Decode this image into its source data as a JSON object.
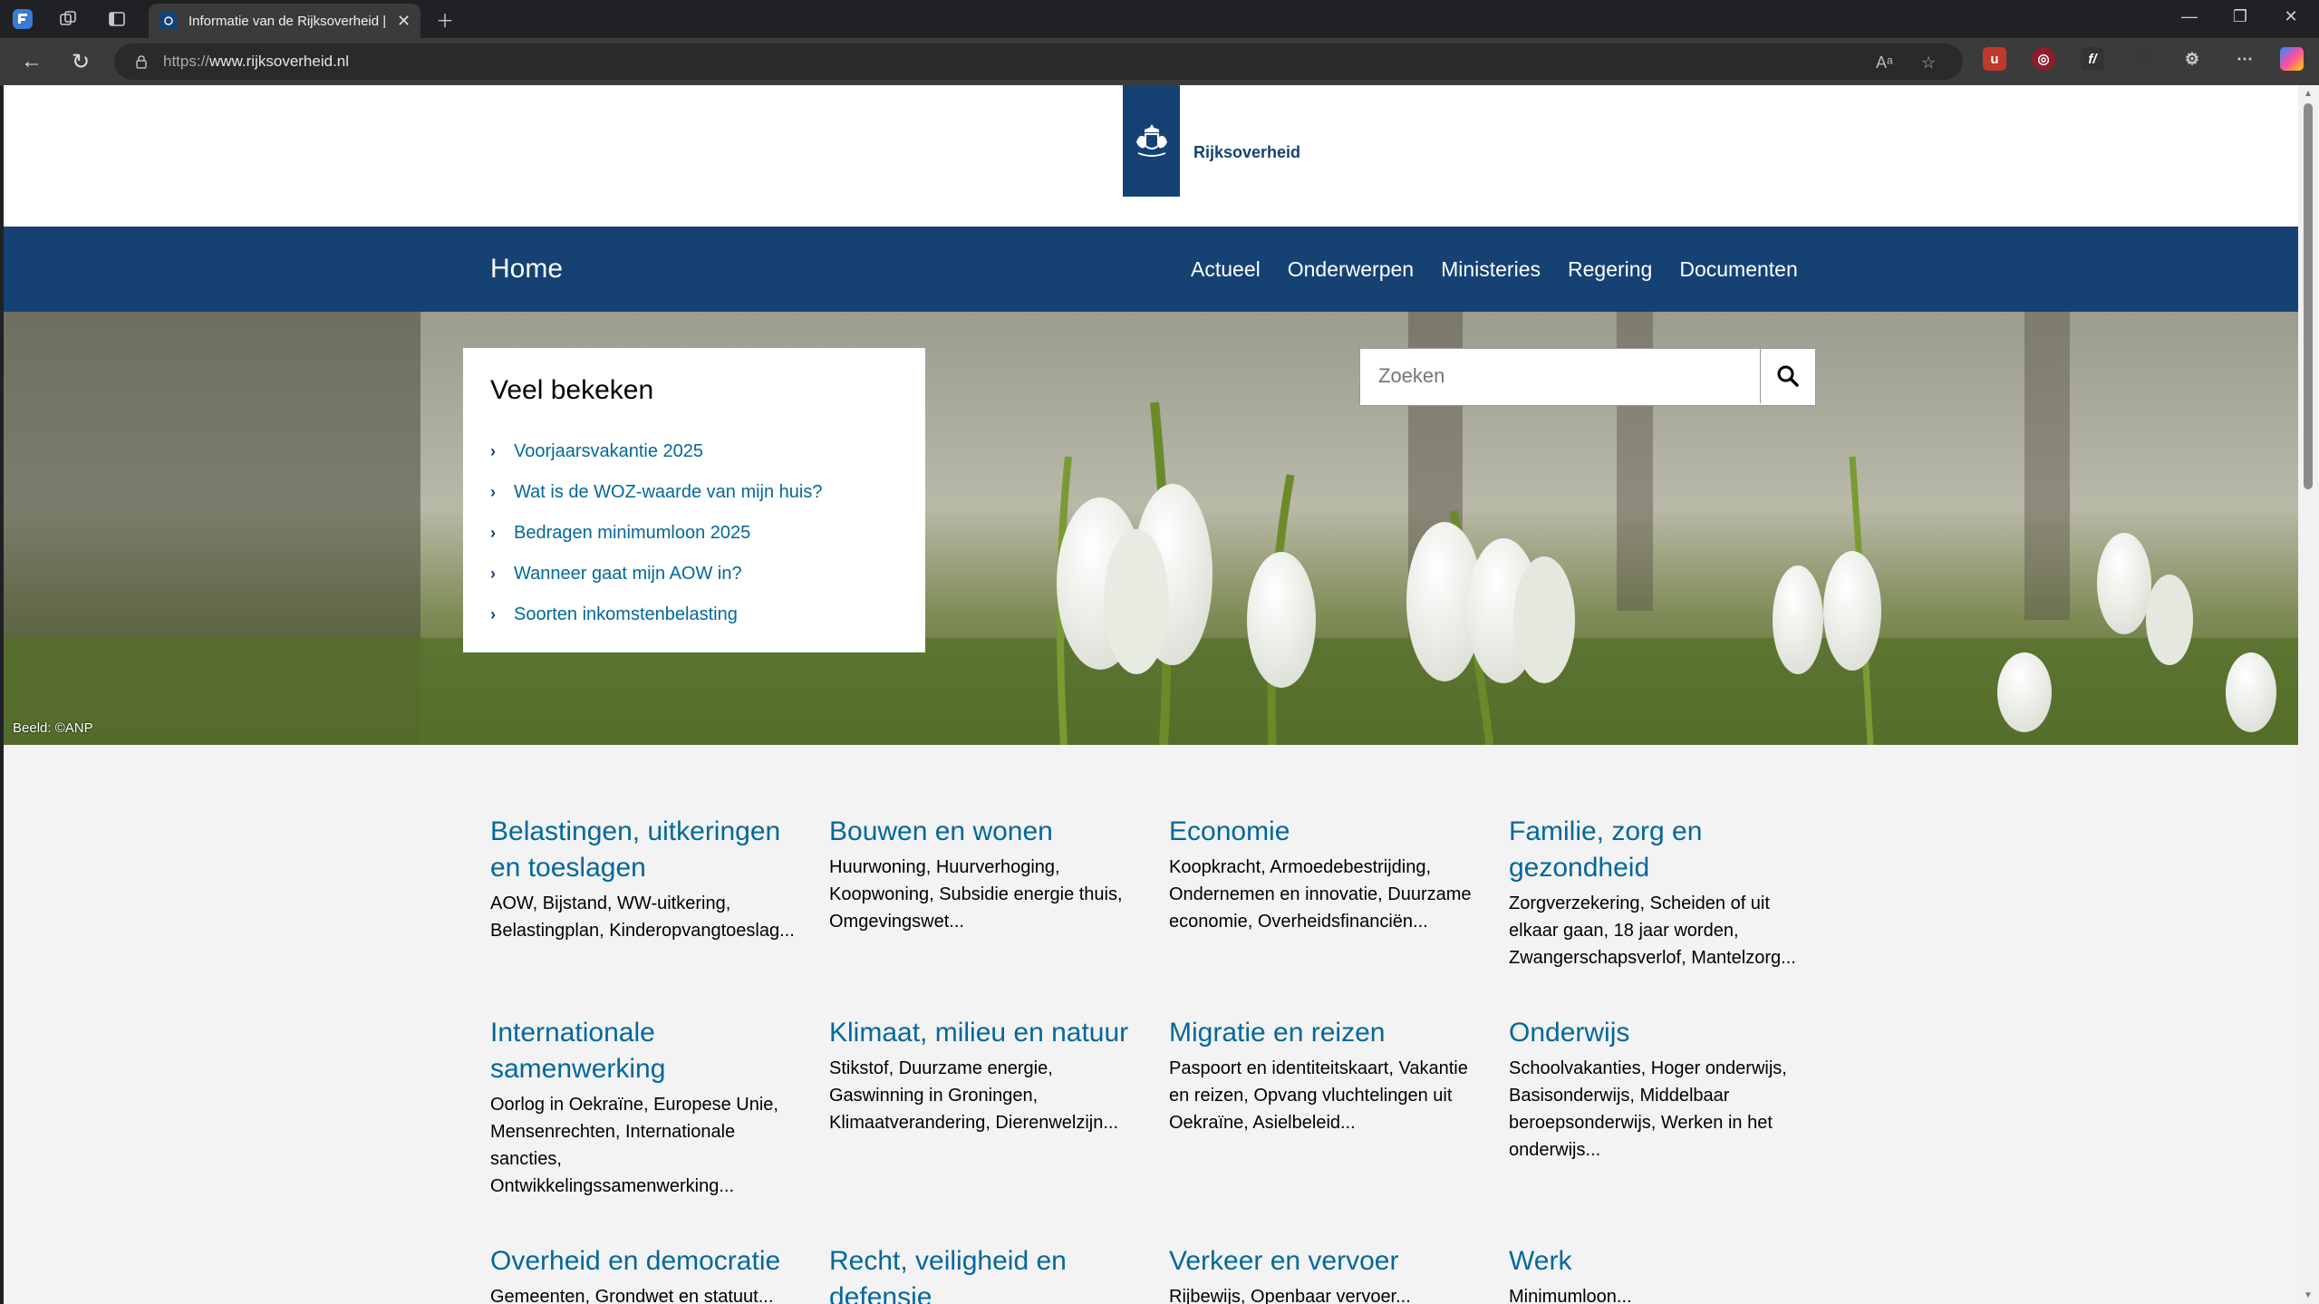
{
  "browser": {
    "tab_title": "Informatie van de Rijksoverheid |",
    "url_prefix": "https://",
    "url_host": "www.rijksoverheid.nl"
  },
  "site": {
    "logo_text": "Rijksoverheid",
    "nav_home": "Home",
    "nav_items": [
      "Actueel",
      "Onderwerpen",
      "Ministeries",
      "Regering",
      "Documenten"
    ],
    "colors": {
      "brand": "#154273",
      "link": "#01689b"
    }
  },
  "hero": {
    "credit": "Beeld: ©ANP",
    "popular_title": "Veel bekeken",
    "popular_links": [
      "Voorjaarsvakantie 2025",
      "Wat is de WOZ-waarde van mijn huis?",
      "Bedragen minimumloon 2025",
      "Wanneer gaat mijn AOW in?",
      "Soorten inkomstenbelasting"
    ],
    "search_placeholder": "Zoeken"
  },
  "topics": [
    {
      "title": "Belastingen, uitkeringen en toeslagen",
      "desc": "AOW, Bijstand, WW-uitkering, Belastingplan, Kinderopvangtoeslag..."
    },
    {
      "title": "Bouwen en wonen",
      "desc": "Huurwoning, Huurverhoging, Koopwoning, Subsidie energie thuis, Omgevingswet..."
    },
    {
      "title": "Economie",
      "desc": "Koopkracht, Armoedebestrijding, Ondernemen en innovatie, Duurzame economie, Overheidsfinanciën..."
    },
    {
      "title": "Familie, zorg en gezondheid",
      "desc": "Zorgverzekering, Scheiden of uit elkaar gaan, 18 jaar worden, Zwangerschapsverlof, Mantelzorg..."
    },
    {
      "title": "Internationale samenwerking",
      "desc": "Oorlog in Oekraïne, Europese Unie, Mensenrechten, Internationale sancties, Ontwikkelingssamenwerking..."
    },
    {
      "title": "Klimaat, milieu en natuur",
      "desc": "Stikstof, Duurzame energie, Gaswinning in Groningen, Klimaatverandering, Dierenwelzijn..."
    },
    {
      "title": "Migratie en reizen",
      "desc": "Paspoort en identiteitskaart, Vakantie en reizen, Opvang vluchtelingen uit Oekraïne, Asielbeleid..."
    },
    {
      "title": "Onderwijs",
      "desc": "Schoolvakanties, Hoger onderwijs, Basisonderwijs, Middelbaar beroepsonderwijs, Werken in het onderwijs..."
    },
    {
      "title": "Overheid en democratie",
      "desc": "Gemeenten, Grondwet en statuut..."
    },
    {
      "title": "Recht, veiligheid en defensie",
      "desc": ""
    },
    {
      "title": "Verkeer en vervoer",
      "desc": "Rijbewijs, Openbaar vervoer..."
    },
    {
      "title": "Werk",
      "desc": "Minimumloon..."
    }
  ]
}
